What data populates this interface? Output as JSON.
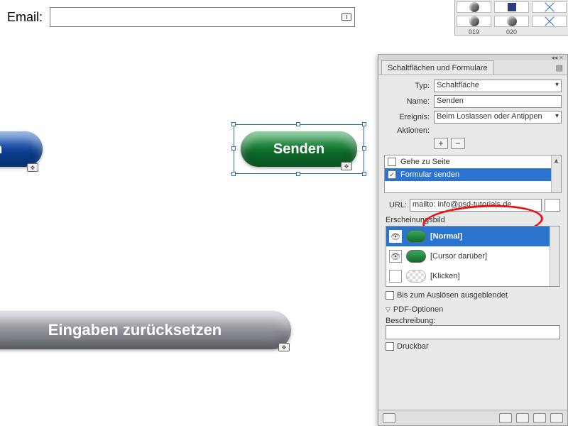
{
  "form": {
    "email_label": "Email:",
    "email_value": ""
  },
  "buttons": {
    "blue_label": "en",
    "green_label": "Senden",
    "gray_label": "Eingaben zurücksetzen"
  },
  "swatches": {
    "labels": [
      "019",
      "020"
    ]
  },
  "panel": {
    "tab": "Schaltflächen und Formulare",
    "flyout_glyph": "▤",
    "top_glyphs": "◂◂ ×",
    "props": {
      "type_label": "Typ:",
      "type_value": "Schaltfläche",
      "name_label": "Name:",
      "name_value": "Senden",
      "event_label": "Ereignis:",
      "event_value": "Beim Loslassen oder Antippen",
      "actions_label": "Aktionen:"
    },
    "action_list": [
      {
        "checked": false,
        "label": "Gehe zu Seite"
      },
      {
        "checked": true,
        "label": "Formular senden"
      }
    ],
    "url": {
      "label": "URL:",
      "value": "mailto: info@psd-tutorials.de"
    },
    "appearance_label": "Erscheinungsbild",
    "states": [
      {
        "eye": true,
        "thumb": "green",
        "label": "[Normal]",
        "selected": true
      },
      {
        "eye": true,
        "thumb": "green",
        "label": "[Cursor darüber]",
        "selected": false
      },
      {
        "eye": false,
        "thumb": "none",
        "label": "[Klicken]",
        "selected": false
      }
    ],
    "hidden_chk": {
      "checked": false,
      "label": "Bis zum Auslösen ausgeblendet"
    },
    "pdf_section": "PDF-Optionen",
    "description_label": "Beschreibung:",
    "description_value": "",
    "printable": {
      "checked": false,
      "label": "Druckbar"
    }
  }
}
